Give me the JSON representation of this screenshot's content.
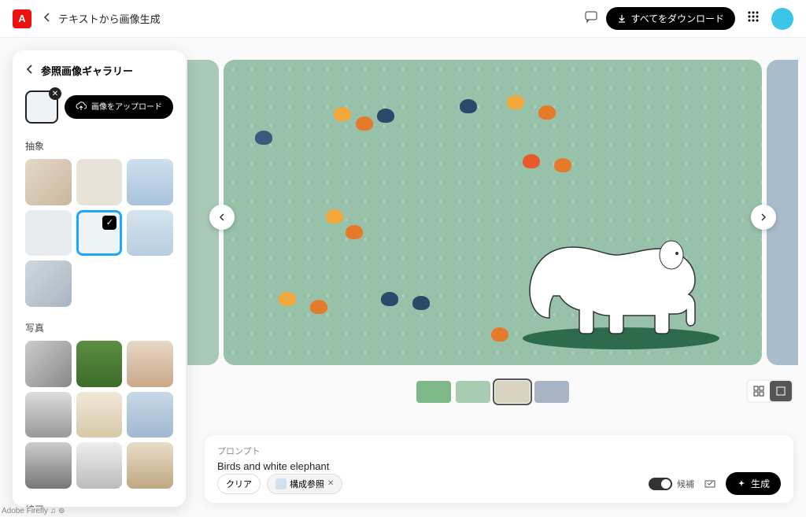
{
  "header": {
    "page_title": "テキストから画像生成",
    "download_all": "すべてをダウンロード"
  },
  "panel": {
    "title": "参照画像ギャラリー",
    "upload_label": "画像をアップロード",
    "sections": {
      "abstract": "抽象",
      "photo": "写真",
      "lineart": "線画"
    }
  },
  "prompt": {
    "label": "プロンプト",
    "text": "Birds and white elephant",
    "clear": "クリア",
    "ref_chip": "構成参照",
    "candidates_label": "候補",
    "generate": "生成"
  },
  "footer": "Adobe Firefly ♫ ⊚"
}
